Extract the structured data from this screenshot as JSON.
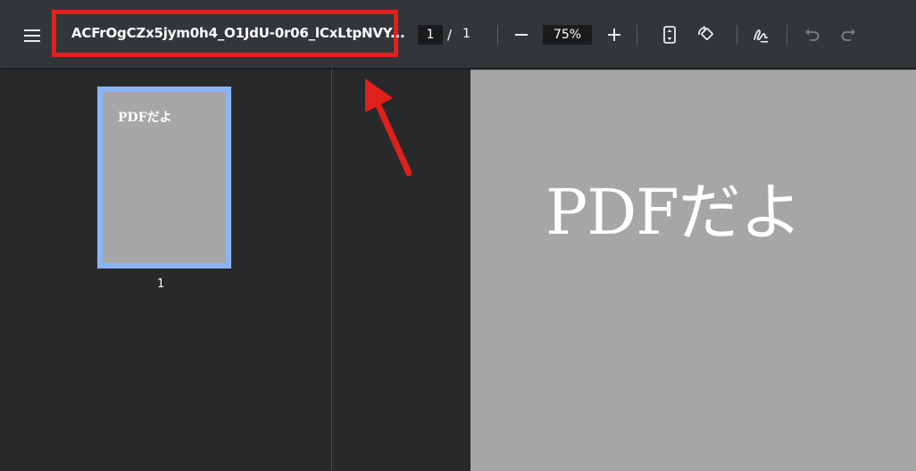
{
  "toolbar": {
    "menu_icon": "hamburger-menu-icon",
    "title": "ACFrOgCZx5jym0h4_O1JdU-0r06_lCxLtpNVY...",
    "page_current": "1",
    "page_separator": "/",
    "page_total": "1",
    "zoom_out_icon": "minus-icon",
    "zoom_value": "75%",
    "zoom_in_icon": "plus-icon",
    "fit_icon": "fit-to-page-icon",
    "rotate_icon": "rotate-icon",
    "annotate_icon": "pen-annotate-icon",
    "undo_icon": "undo-icon",
    "redo_icon": "redo-icon"
  },
  "sidebar": {
    "thumbnails": [
      {
        "text": "PDFだよ",
        "label": "1"
      }
    ]
  },
  "document": {
    "page_text": "PDFだよ"
  },
  "annotations": {
    "highlight_color": "#e0201b",
    "arrow_color": "#e0201b"
  },
  "colors": {
    "toolbar_bg": "#323639",
    "viewer_bg": "#28292b",
    "page_bg": "#a6a6a6",
    "thumb_border": "#8ab4f8"
  }
}
